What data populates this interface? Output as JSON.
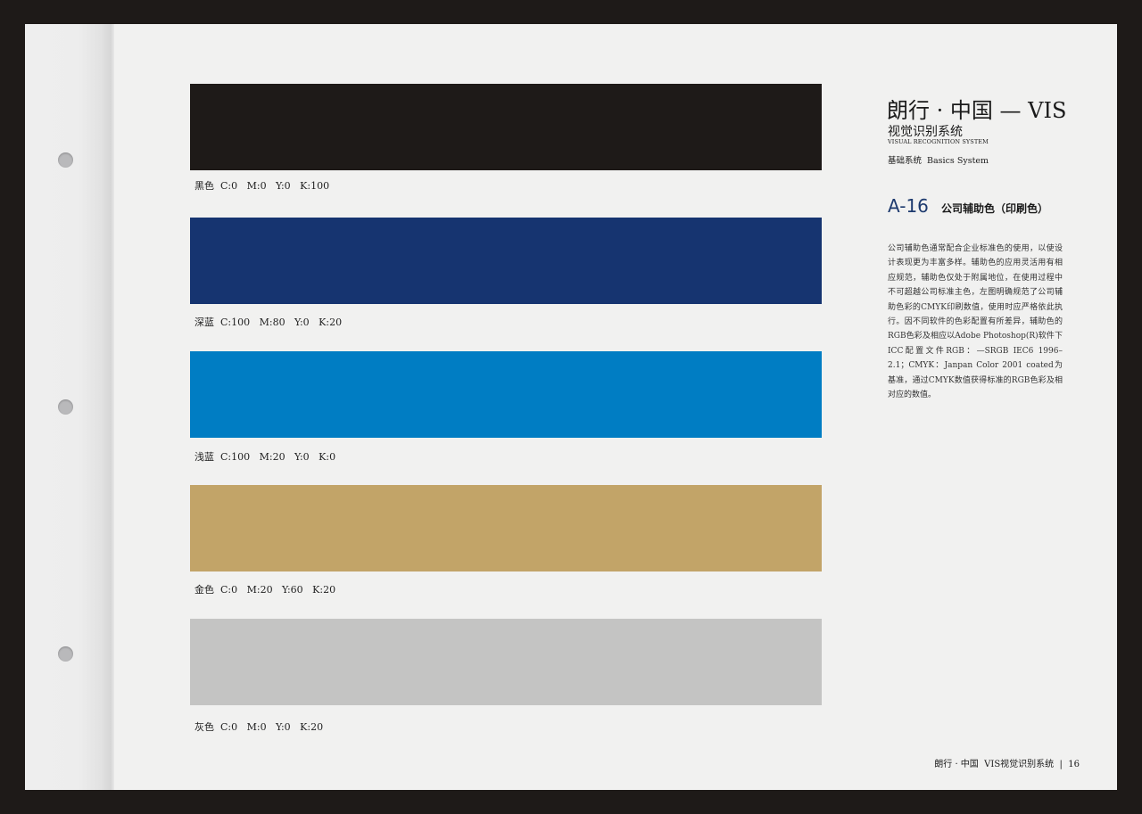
{
  "header": {
    "brand_title": "朗行 · 中国 — VIS",
    "subtitle": "视觉识别系统",
    "subtitle_en": "VISUAL RECOGNITION SYSTEM",
    "category": "基础系统  Basics System"
  },
  "section": {
    "code": "A-16",
    "title": "公司辅助色（印刷色）",
    "description": "公司辅助色通常配合企业标准色的使用，以使设计表现更为丰富多样。辅助色的应用灵活用有相应规范，辅助色仅处于附属地位，在使用过程中不可超越公司标准主色，左图明确规范了公司辅助色彩的CMYK印刷数值，使用时应严格依此执行。因不同软件的色彩配置有所差异，辅助色的RGB色彩及相应以Adobe Photoshop(R)软件下ICC配置文件RGB：—SRGB IEC6 1996–2.1；CMYK：Janpan Color 2001 coated为基准，通过CMYK数值获得标准的RGB色彩及相对应的数值。"
  },
  "swatches": [
    {
      "label": "黑色  C:0   M:0   Y:0   K:100",
      "color": "#1e1a18"
    },
    {
      "label": "深蓝  C:100   M:80   Y:0   K:20",
      "color": "#163470"
    },
    {
      "label": "浅蓝  C:100   M:20   Y:0   K:0",
      "color": "#007dc3"
    },
    {
      "label": "金色  C:0   M:20   Y:60   K:20",
      "color": "#c2a468"
    },
    {
      "label": "灰色  C:0   M:0   Y:0   K:20",
      "color": "#c4c4c3"
    }
  ],
  "footer": {
    "text": "朗行 · 中国  VIS视觉识别系统  |  16"
  }
}
